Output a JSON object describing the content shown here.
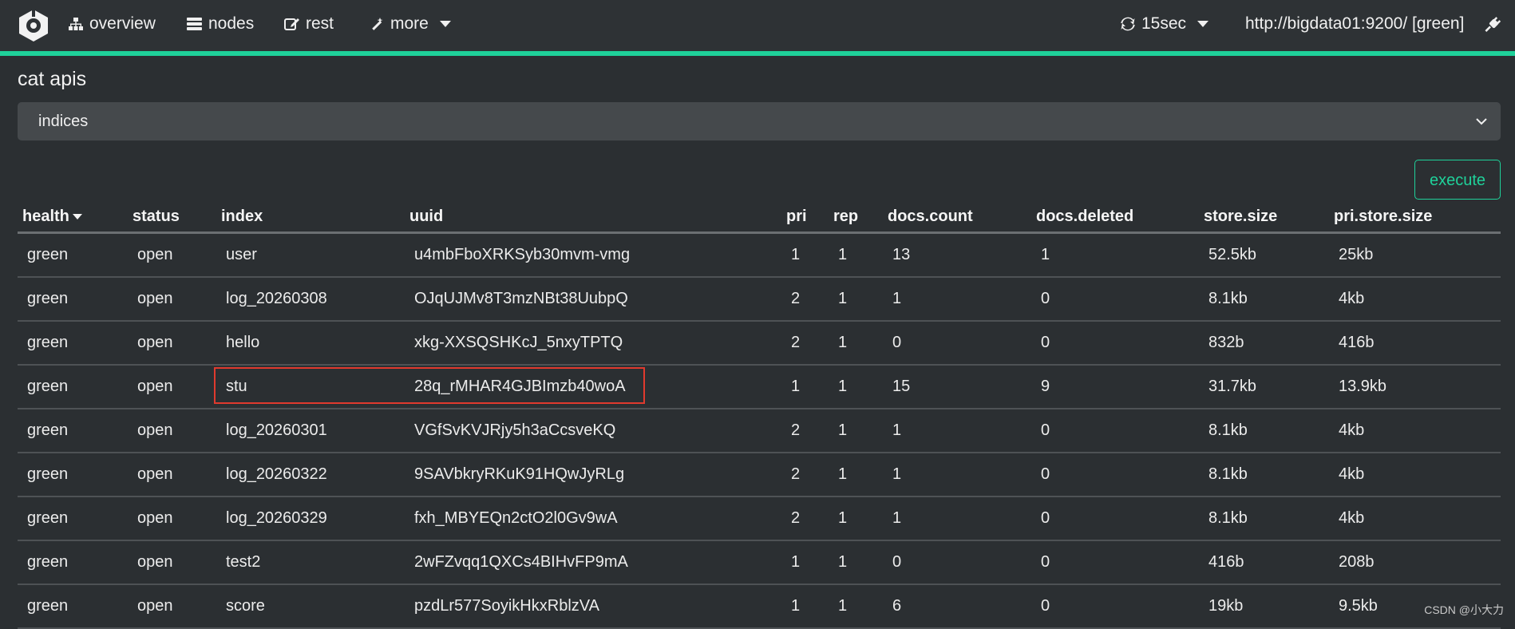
{
  "nav": {
    "overview": "overview",
    "nodes": "nodes",
    "rest": "rest",
    "more": "more",
    "refresh": "15sec",
    "cluster": "http://bigdata01:9200/ [green]"
  },
  "page": {
    "title": "cat apis",
    "select_value": "indices",
    "execute_label": "execute"
  },
  "table": {
    "headers": [
      "health",
      "status",
      "index",
      "uuid",
      "pri",
      "rep",
      "docs.count",
      "docs.deleted",
      "store.size",
      "pri.store.size"
    ],
    "rows": [
      [
        "green",
        "open",
        "user",
        "u4mbFboXRKSyb30mvm-vmg",
        "1",
        "1",
        "13",
        "1",
        "52.5kb",
        "25kb"
      ],
      [
        "green",
        "open",
        "log_20260308",
        "OJqUJMv8T3mzNBt38UubpQ",
        "2",
        "1",
        "1",
        "0",
        "8.1kb",
        "4kb"
      ],
      [
        "green",
        "open",
        "hello",
        "xkg-XXSQSHKcJ_5nxyTPTQ",
        "2",
        "1",
        "0",
        "0",
        "832b",
        "416b"
      ],
      [
        "green",
        "open",
        "stu",
        "28q_rMHAR4GJBImzb40woA",
        "1",
        "1",
        "15",
        "9",
        "31.7kb",
        "13.9kb"
      ],
      [
        "green",
        "open",
        "log_20260301",
        "VGfSvKVJRjy5h3aCcsveKQ",
        "2",
        "1",
        "1",
        "0",
        "8.1kb",
        "4kb"
      ],
      [
        "green",
        "open",
        "log_20260322",
        "9SAVbkryRKuK91HQwJyRLg",
        "2",
        "1",
        "1",
        "0",
        "8.1kb",
        "4kb"
      ],
      [
        "green",
        "open",
        "log_20260329",
        "fxh_MBYEQn2ctO2l0Gv9wA",
        "2",
        "1",
        "1",
        "0",
        "8.1kb",
        "4kb"
      ],
      [
        "green",
        "open",
        "test2",
        "2wFZvqq1QXCs4BIHvFP9mA",
        "1",
        "1",
        "0",
        "0",
        "416b",
        "208b"
      ],
      [
        "green",
        "open",
        "score",
        "pzdLr577SoyikHkxRblzVA",
        "1",
        "1",
        "6",
        "0",
        "19kb",
        "9.5kb"
      ]
    ]
  },
  "watermark": "CSDN @小大力",
  "colors": {
    "accent": "#1fd19a",
    "highlight_box": "#e03a2e",
    "background": "#2b2f32"
  }
}
